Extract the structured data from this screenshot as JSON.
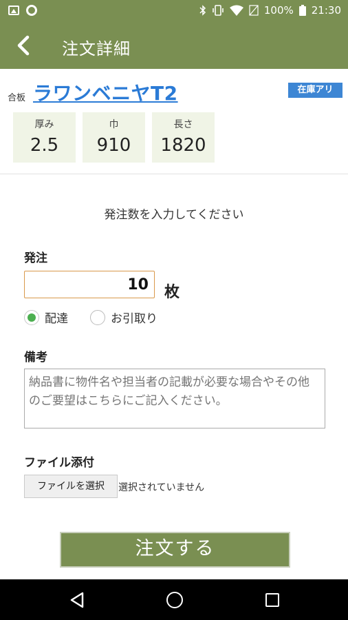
{
  "status_bar": {
    "battery": "100%",
    "time": "21:30"
  },
  "app_bar": {
    "title": "注文詳細"
  },
  "product": {
    "category": "合板",
    "name": "ラワンベニヤT2",
    "stock_badge": "在庫アリ",
    "specs": [
      {
        "label": "厚み",
        "value": "2.5"
      },
      {
        "label": "巾",
        "value": "910"
      },
      {
        "label": "長さ",
        "value": "1820"
      }
    ]
  },
  "form": {
    "instruction": "発注数を入力してください",
    "order_label": "発注",
    "quantity": "10",
    "unit": "枚",
    "delivery_options": [
      {
        "label": "配達",
        "selected": true
      },
      {
        "label": "お引取り",
        "selected": false
      }
    ],
    "notes_label": "備考",
    "notes_placeholder": "納品書に物件名や担当者の記載が必要な場合やその他のご要望はこちらにご記入ください。",
    "attachment_label": "ファイル添付",
    "file_button": "ファイルを選択",
    "file_status": "選択されていません",
    "submit_button": "注文する"
  },
  "colors": {
    "header_green": "#7a8f52",
    "link_blue": "#2b7bd6",
    "badge_blue": "#3d86d4",
    "spec_bg": "#f0f4e6",
    "input_border": "#d9984a",
    "radio_green": "#4caf50"
  },
  "icons": {
    "back": "chevron-left-icon",
    "nav_back": "triangle-back-icon",
    "nav_home": "circle-home-icon",
    "nav_recent": "square-recent-icon"
  }
}
